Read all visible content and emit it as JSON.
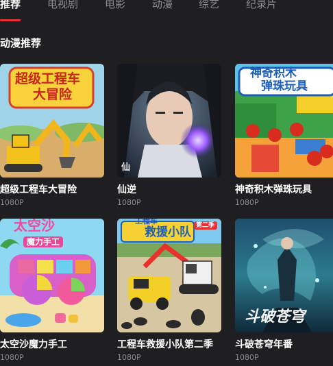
{
  "tabs": [
    "推荐",
    "电视剧",
    "电影",
    "动漫",
    "综艺",
    "纪录片"
  ],
  "section": {
    "title": "动漫推荐"
  },
  "cards": [
    {
      "title": "超级工程车大冒险",
      "quality": "1080P",
      "poster_lines": [
        "超级工程车",
        "大冒险"
      ]
    },
    {
      "title": "仙逆",
      "quality": "1080P",
      "poster_lines": [
        "仙"
      ]
    },
    {
      "title": "神奇积木弹珠玩具",
      "quality": "1080P",
      "poster_lines": [
        "神奇积木",
        "弹珠玩具"
      ]
    },
    {
      "title": "太空沙魔力手工",
      "quality": "1080P",
      "poster_lines": [
        "太空沙",
        "魔力手工"
      ]
    },
    {
      "title": "工程车救援小队第二季",
      "quality": "1080P",
      "poster_lines": [
        "工程车",
        "救援小队",
        "第二季"
      ]
    },
    {
      "title": "斗破苍穹年番",
      "quality": "1080P",
      "poster_lines": [
        "斗破苍穹"
      ]
    }
  ],
  "colors": {
    "background": "#1f1f21",
    "accent": "#e8312b",
    "tab_inactive": "#8d8d92",
    "subtext": "#8a8a8f"
  }
}
